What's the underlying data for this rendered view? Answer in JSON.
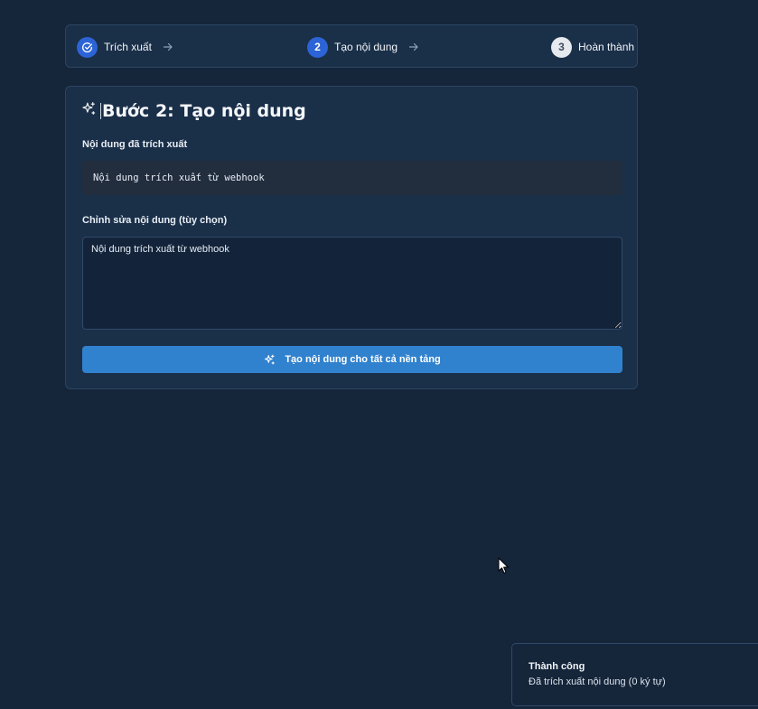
{
  "stepper": {
    "steps": [
      {
        "number": "",
        "label": "Trích xuất",
        "state": "done",
        "icon": "check-circle-icon"
      },
      {
        "number": "2",
        "label": "Tạo nội dung",
        "state": "active"
      },
      {
        "number": "3",
        "label": "Hoàn thành",
        "state": "pending"
      }
    ]
  },
  "card": {
    "title": "Bước 2: Tạo nội dung",
    "title_icon": "sparkles-icon",
    "extracted_label": "Nội dung đã trích xuất",
    "extracted_value": "Nội dung trích xuất từ webhook",
    "edit_label": "Chỉnh sửa nội dung (tùy chọn)",
    "edit_value": "Nội dung trích xuất từ webhook",
    "generate_button": "Tạo nội dung cho tất cả nền tảng"
  },
  "toast": {
    "title": "Thành công",
    "message": "Đã trích xuất nội dung (0 ký tự)"
  },
  "colors": {
    "background": "#15253a",
    "card": "#1a2f48",
    "accent": "#3182ce",
    "step_active": "#2c63d6"
  }
}
